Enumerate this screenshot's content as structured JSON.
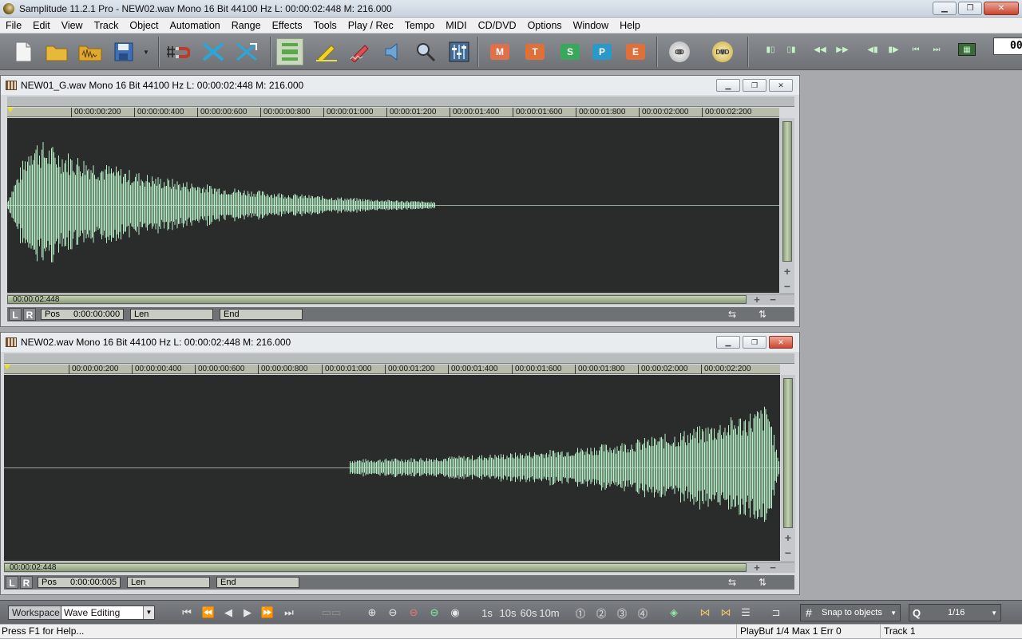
{
  "app": {
    "title": "Samplitude 11.2.1 Pro - NEW02.wav  Mono 16 Bit 44100 Hz L: 00:00:02:448 M: 216.000"
  },
  "menu": [
    "File",
    "Edit",
    "View",
    "Track",
    "Object",
    "Automation",
    "Range",
    "Effects",
    "Tools",
    "Play / Rec",
    "Tempo",
    "MIDI",
    "CD/DVD",
    "Options",
    "Window",
    "Help"
  ],
  "toolbar": {
    "letter_buttons": [
      "M",
      "T",
      "S",
      "P",
      "E"
    ],
    "disc_labels": [
      "CD",
      "DVD"
    ],
    "counter": "00"
  },
  "wave_windows": [
    {
      "title": "NEW01_G.wav  Mono 16 Bit 44100 Hz L: 00:00:02:448 M: 216.000",
      "ticks": [
        "00:00:00:200",
        "00:00:00:400",
        "00:00:00:600",
        "00:00:00:800",
        "00:00:01:000",
        "00:00:01:200",
        "00:00:01:400",
        "00:00:01:600",
        "00:00:01:800",
        "00:00:02:000",
        "00:00:02:200"
      ],
      "scroll_label": "00:00:02:448",
      "lr": [
        "L",
        "R"
      ],
      "pos_label": "Pos",
      "pos_value": "0:00:00:000",
      "len_label": "Len",
      "end_label": "End"
    },
    {
      "title": "NEW02.wav  Mono 16 Bit 44100 Hz L: 00:00:02:448 M: 216.000",
      "ticks": [
        "00:00:00:200",
        "00:00:00:400",
        "00:00:00:600",
        "00:00:00:800",
        "00:00:01:000",
        "00:00:01:200",
        "00:00:01:400",
        "00:00:01:600",
        "00:00:01:800",
        "00:00:02:000",
        "00:00:02:200"
      ],
      "scroll_label": "00:00:02:448",
      "lr": [
        "L",
        "R"
      ],
      "pos_label": "Pos",
      "pos_value": "0:00:00:005",
      "len_label": "Len",
      "end_label": "End"
    }
  ],
  "bottom": {
    "workspace_label": "Workspace",
    "workspace_value": "Wave Editing",
    "time_buttons": [
      "1s",
      "10s",
      "60s",
      "10m"
    ],
    "snap_label": "Snap to objects",
    "q_label": "Q",
    "q_value": "1/16"
  },
  "status": {
    "help": "Press F1 for Help...",
    "playbuf": "PlayBuf 1/4  Max 1  Err 0",
    "track": "Track 1"
  },
  "colors": {
    "waveform": "#b8f0c8",
    "wave_bg": "#2a2c2b",
    "toolbar_bg": "#7a7d81"
  }
}
